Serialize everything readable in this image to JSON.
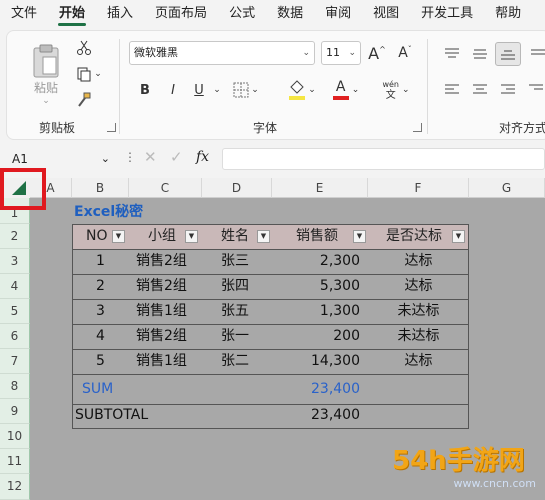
{
  "menu": [
    "文件",
    "开始",
    "插入",
    "页面布局",
    "公式",
    "数据",
    "审阅",
    "视图",
    "开发工具",
    "帮助"
  ],
  "ribbon": {
    "clipboard_label": "剪贴板",
    "paste_label": "粘贴",
    "font_label": "字体",
    "align_label": "对齐方式",
    "font_name": "微软雅黑",
    "font_size": "11",
    "bold": "B",
    "italic": "I",
    "underline": "U",
    "grow_font": "A",
    "shrink_font": "A",
    "font_color_letter": "A",
    "wen_top": "wén",
    "wen_bottom": "文"
  },
  "formula_bar": {
    "name_box": "A1",
    "fx": "fx",
    "formula": ""
  },
  "columns": [
    "A",
    "B",
    "C",
    "D",
    "E",
    "F",
    "G"
  ],
  "rows": [
    "1",
    "2",
    "3",
    "4",
    "5",
    "6",
    "7",
    "8",
    "9",
    "10",
    "11",
    "12"
  ],
  "sheet": {
    "title": "Excel秘密",
    "headers": [
      "NO",
      "小组",
      "姓名",
      "销售额",
      "是否达标"
    ],
    "data": [
      [
        "1",
        "销售2组",
        "张三",
        "2,300",
        "达标"
      ],
      [
        "2",
        "销售2组",
        "张四",
        "5,300",
        "达标"
      ],
      [
        "3",
        "销售1组",
        "张五",
        "1,300",
        "未达标"
      ],
      [
        "4",
        "销售2组",
        "张一",
        "200",
        "未达标"
      ],
      [
        "5",
        "销售1组",
        "张二",
        "14,300",
        "达标"
      ]
    ],
    "sum_label": "SUM",
    "sum_value": "23,400",
    "subtotal_label": "SUBTOTAL",
    "subtotal_value": "23,400"
  },
  "watermark": {
    "text": "54h手游网",
    "url": "www.cncn.com"
  },
  "colors": {
    "accent_green": "#1e7145",
    "highlight_red": "#e0191f",
    "title_blue": "#1f5fbf",
    "sum_blue": "#2a62c9",
    "header_fill": "#c9b8b8"
  }
}
